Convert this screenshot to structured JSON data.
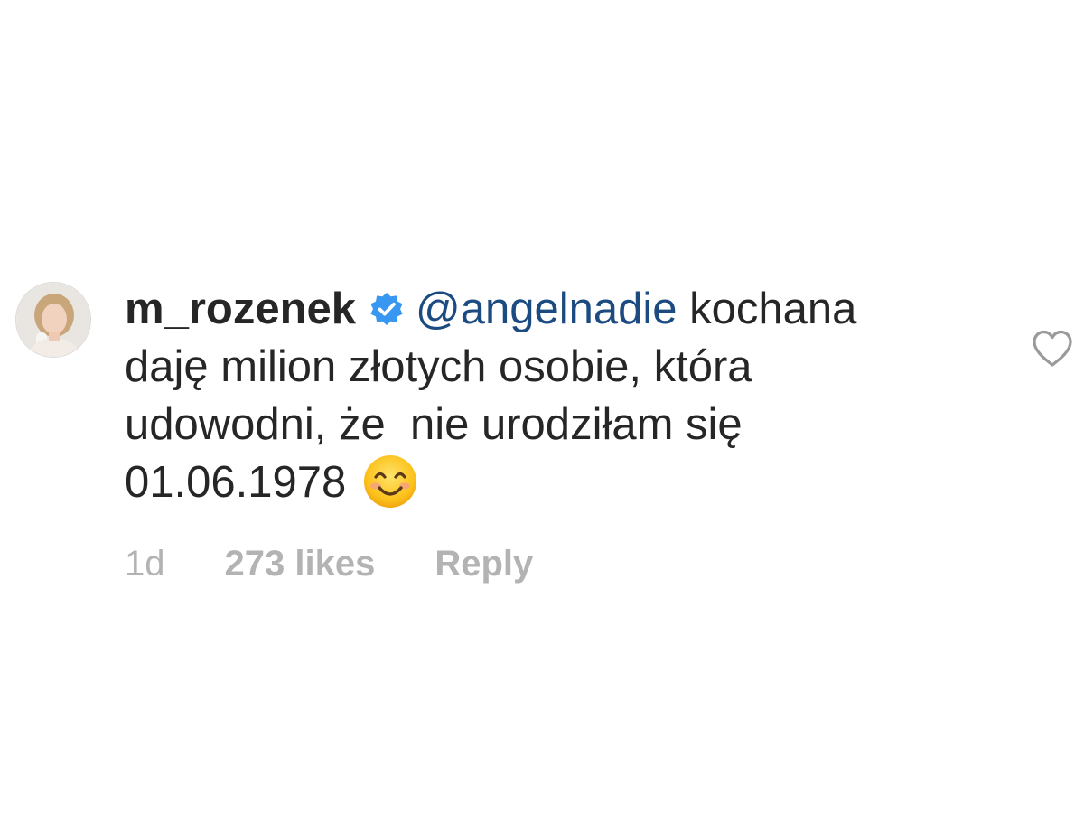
{
  "comment": {
    "username": "m_rozenek",
    "verified": true,
    "mention": "@angelnadie",
    "text_lines": [
      " kochana",
      "daję milion złotych osobie, która",
      "udowodni, że  nie urodziłam się",
      "01.06.1978"
    ],
    "emoji": "smiling-face-with-smiling-eyes",
    "time": "1d",
    "likes": "273 likes",
    "reply_label": "Reply"
  },
  "icons": {
    "verified": "verified-badge-icon",
    "like": "heart-outline-icon"
  },
  "colors": {
    "text": "#262626",
    "mention": "#1b4b80",
    "meta": "#b3b3b3",
    "verified_badge": "#3897f0",
    "heart": "#9a9a9a"
  }
}
